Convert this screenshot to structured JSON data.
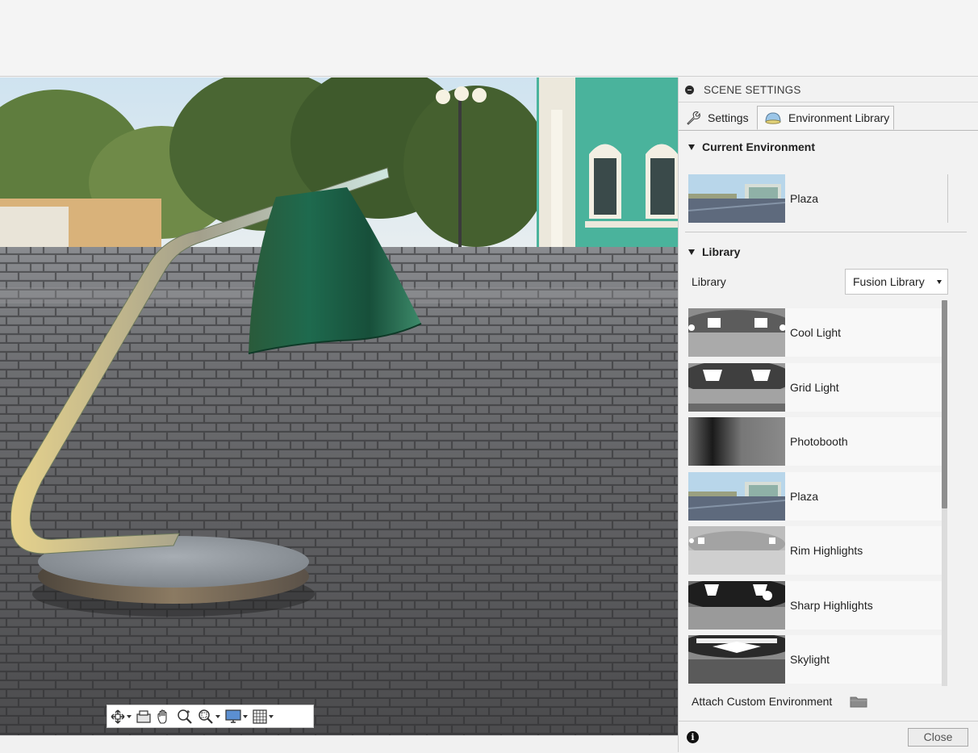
{
  "panel": {
    "title": "SCENE SETTINGS",
    "tabs": [
      {
        "label": "Settings",
        "icon": "wrench-icon"
      },
      {
        "label": "Environment Library",
        "icon": "environment-dome-icon",
        "active": true
      }
    ],
    "current_environment": {
      "heading": "Current Environment",
      "name": "Plaza"
    },
    "library": {
      "heading": "Library",
      "label": "Library",
      "selected": "Fusion Library",
      "items": [
        {
          "label": "Cool Light"
        },
        {
          "label": "Grid Light"
        },
        {
          "label": "Photobooth"
        },
        {
          "label": "Plaza"
        },
        {
          "label": "Rim Highlights"
        },
        {
          "label": "Sharp Highlights"
        },
        {
          "label": "Skylight"
        }
      ]
    },
    "attach_label": "Attach Custom Environment",
    "close_label": "Close"
  },
  "colors": {
    "lamp_shade": "#1f5c45",
    "panel_bg": "#f2f2f2",
    "scrollbar_thumb": "#8f8f8f"
  }
}
